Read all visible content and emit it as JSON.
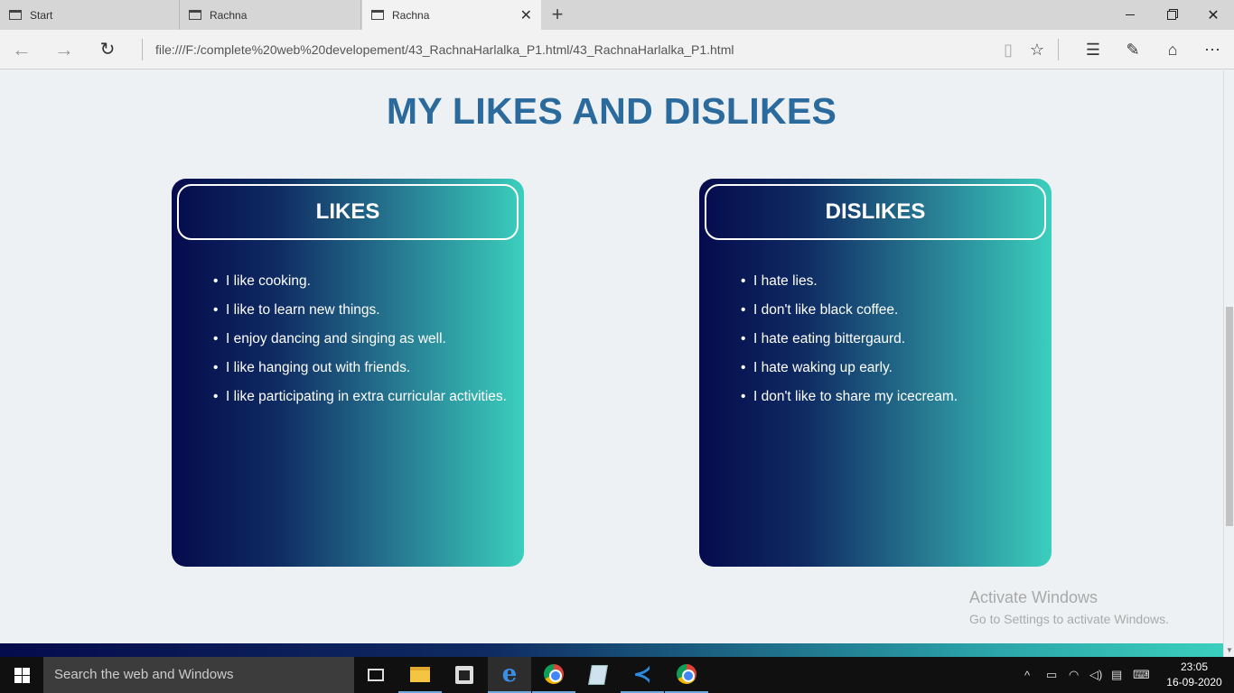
{
  "browser": {
    "tabs": [
      {
        "label": "Start"
      },
      {
        "label": "Rachna"
      },
      {
        "label": "Rachna"
      }
    ],
    "url": "file:///F:/complete%20web%20developement/43_RachnaHarlalka_P1.html/43_RachnaHarlalka_P1.html"
  },
  "page": {
    "heading": "MY LIKES AND DISLIKES",
    "likes": {
      "title": "LIKES",
      "items": [
        "I like cooking.",
        "I like to learn new things.",
        "I enjoy dancing and singing as well.",
        "I like hanging out with friends.",
        "I like participating in extra curricular activities."
      ]
    },
    "dislikes": {
      "title": "DISLIKES",
      "items": [
        "I hate lies.",
        "I don't like black coffee.",
        "I hate eating bittergaurd.",
        "I hate waking up early.",
        "I don't like to share my icecream."
      ]
    },
    "colors": {
      "heading": "#2a6a9c",
      "gradient_start": "#050b4d",
      "gradient_end": "#3bcfbd",
      "background": "#eef1f3"
    }
  },
  "watermark": {
    "line1": "Activate Windows",
    "line2": "Go to Settings to activate Windows."
  },
  "taskbar": {
    "search_placeholder": "Search the web and Windows",
    "time": "23:05",
    "date": "16-09-2020"
  }
}
